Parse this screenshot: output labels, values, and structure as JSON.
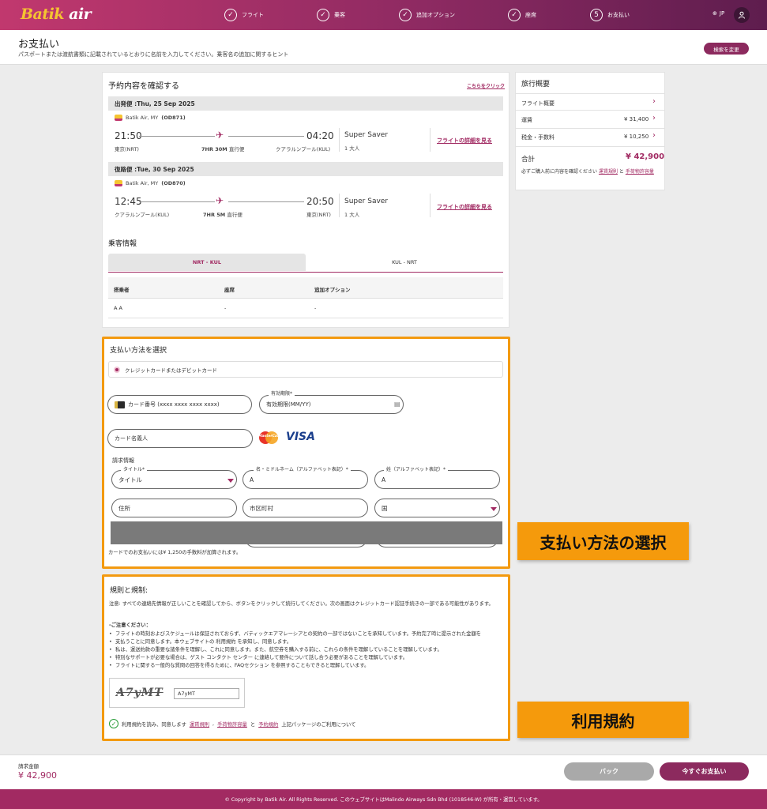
{
  "header": {
    "logo_part1": "Batik",
    "logo_part2": " air",
    "steps": [
      {
        "label": "フライト",
        "icon": "✓"
      },
      {
        "label": "乗客",
        "icon": "✓"
      },
      {
        "label": "追加オプション",
        "icon": "✓"
      },
      {
        "label": "座席",
        "icon": "✓"
      },
      {
        "label": "お支払い",
        "icon": "5"
      }
    ],
    "lang": "JP"
  },
  "page": {
    "title": "お支払い",
    "subtitle": "パスポートまたは渡航書類に記載されているとおりに名前を入力してください。乗客名の追加に関するヒント",
    "change_search": "検索を変更"
  },
  "booking": {
    "heading": "予約内容を確認する",
    "click_here": "こちらをクリック",
    "outbound": {
      "band": "出発便 :Thu, 25 Sep 2025",
      "airline": "Batik Air, MY",
      "flight_no": "(OD871)",
      "dep_time": "21:50",
      "dep_place": "東京(NRT)",
      "duration": "7HR 30M",
      "stops": "直行便",
      "arr_time": "04:20",
      "arr_place": "クアラルンプール(KUL)",
      "fare": "Super Saver",
      "pax": "1 大人",
      "details": "フライトの詳細を見る"
    },
    "inbound": {
      "band": "復路便 :Tue, 30 Sep 2025",
      "airline": "Batik Air, MY",
      "flight_no": "(OD870)",
      "dep_time": "12:45",
      "dep_place": "クアラルンプール(KUL)",
      "duration": "7HR 5M",
      "stops": "直行便",
      "arr_time": "20:50",
      "arr_place": "東京(NRT)",
      "fare": "Super Saver",
      "pax": "1 大人",
      "details": "フライトの詳細を見る"
    }
  },
  "passenger": {
    "heading": "乗客情報",
    "tabs": [
      "NRT - KUL",
      "KUL - NRT"
    ],
    "columns": [
      "搭乗者",
      "座席",
      "追加オプション"
    ],
    "row": [
      "A A",
      "-",
      "-"
    ]
  },
  "summary": {
    "heading": "旅行概要",
    "flight_overview": "フライト概要",
    "fare_label": "運賃",
    "fare_value": "¥ 31,400",
    "tax_label": "税金・手数料",
    "tax_value": "¥ 10,250",
    "total_label": "合計",
    "total_value": "¥ 42,900",
    "note_pre": "必ずご購入前に内容を確認ください",
    "note_link1": "運賃規則",
    "note_and": "と",
    "note_link2": "手荷物許",
    "note_link2b": "容量"
  },
  "payment": {
    "heading": "支払い方法を選択",
    "method": "クレジットカードまたはデビットカード",
    "card_number": "カード番号 (xxxx xxxx xxxx xxxx)",
    "expiry_label": "有効期限*",
    "expiry_placeholder": "有効期限(MM/YY)",
    "cardholder": "カード名義人",
    "brand_mc": "MasterCard",
    "brand_visa": "VISA",
    "billing_heading": "請求情報",
    "title_label": "タイトル*",
    "title_value": "タイトル",
    "first_label": "名・ミドルネーム（アルファベット表記）*",
    "first_value": "A",
    "last_label": "姓（アルファベット表記）*",
    "last_value": "A",
    "address": "住所",
    "city": "市区町村",
    "country": "国",
    "fee_note": "カードでのお支払いには¥ 1,250の手数料が加算されます。"
  },
  "rules": {
    "heading": "規則と規制:",
    "note": "注意: すべての連絡先情報が正しいことを確認してから、ボタンをクリックして続行してください。次の画面はクレジットカード認証手続きの一部である可能性があります。",
    "attention": "-ご注意ください：",
    "items": [
      "フライトの時刻およびスケジュールは保証されておらず、バティックエアマレーシアとの契約の一部ではないことを承知しています。予約完了時に提示された金額を",
      "支払うことに同意します。本ウェブサイトの 利用規約 を承知し、同意します。",
      "私は、運送約款の重要な諸条件を理解し、これに同意します。また、航空券を購入する前に、これらの条件を理解していることを理解しています。",
      "特別なサポートが必要な場合は、ゲスト コンタクト センター に連絡して要件について話し合う必要があることを理解しています。",
      "フライトに関する一般的な質問の回答を得るために、FAQセクション を参照することもできると理解しています。"
    ],
    "captcha_img": "A7yMT",
    "captcha_value": "A7yMT",
    "agree_pre": "利用規約を読み、同意します",
    "agree_link1": "運賃規則",
    "agree_sep": ",",
    "agree_link2": "手荷物許容量",
    "agree_and": "と",
    "agree_link3": "予約規約",
    "agree_post": "上記パッケージのご利用について"
  },
  "banners": {
    "payment": "支払い方法の選択",
    "terms": "利用規約"
  },
  "footer": {
    "amount_label": "請求金額",
    "amount_value": "¥ 42,900",
    "back": "バック",
    "pay_now": "今すぐお支払い",
    "copyright": "© Copyright by Batik Air. All Rights Reserved. このウェブサイトはMalindo Airways Sdn Bhd (1018546-W) が所有・運営しています。"
  },
  "colors": {
    "brand": "#a22a62",
    "accent_orange": "#f39a10"
  }
}
